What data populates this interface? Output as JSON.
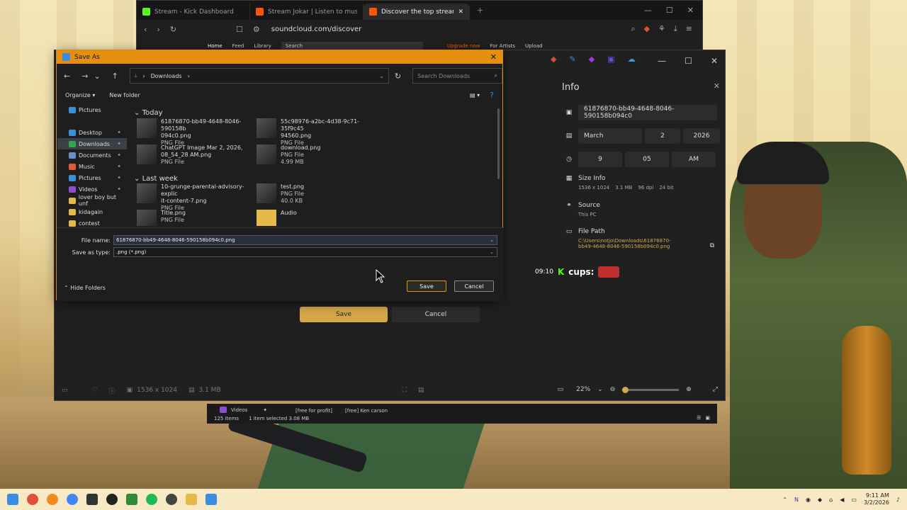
{
  "browser": {
    "tabs": [
      {
        "label": "Stream - Kick Dashboard",
        "color": "#53fc18"
      },
      {
        "label": "Stream Jokar | Listen to music album",
        "color": "#ff5500"
      },
      {
        "label": "Discover the top streamed music",
        "color": "#ff5500"
      }
    ],
    "url": "soundcloud.com/discover",
    "sc_nav": [
      "Home",
      "Feed",
      "Library"
    ],
    "sc_search": "Search",
    "sc_right": [
      "Upgrade now",
      "For Artists",
      "Upload"
    ]
  },
  "viewer": {
    "info_title": "Info",
    "filename": "61876870-bb49-4648-8046-590158b094c0",
    "date": {
      "month": "March",
      "day": "2",
      "year": "2026"
    },
    "time": {
      "hour": "9",
      "minute": "05",
      "ampm": "AM"
    },
    "size_info": {
      "label": "Size Info",
      "dimensions": "1536 x 1024",
      "size": "3.1 MB",
      "dpi": "96 dpi",
      "bits": "24 bit"
    },
    "source": {
      "label": "Source",
      "value": "This PC"
    },
    "file_path": {
      "label": "File Path",
      "line1": "C:\\Users\\notjo\\Downloads\\61876870-",
      "line2": "bb49-4648-8046-590158b094c0.png"
    },
    "chat": {
      "time": "09:10",
      "text": "cups:"
    },
    "save_label": "Save",
    "cancel_label": "Cancel",
    "bottom": {
      "dimensions": "1536 x 1024",
      "size": "3.1 MB",
      "zoom": "22%",
      "zoom_level": 0.0
    }
  },
  "explorer_strip": {
    "folder": "Videos",
    "items": [
      "[free for profit]",
      "[free] Ken carson"
    ],
    "status": "125 items",
    "selected": "1 item selected  3.08 MB"
  },
  "dialog": {
    "title": "Save As",
    "breadcrumb": "Downloads",
    "search_placeholder": "Search Downloads",
    "organize": "Organize",
    "new_folder": "New folder",
    "nav": [
      {
        "label": "Pictures",
        "color": "#3b8fd6",
        "top": true
      },
      {
        "label": "Desktop",
        "color": "#3b8fd6",
        "pinned": true
      },
      {
        "label": "Downloads",
        "color": "#2ea84b",
        "pinned": true,
        "selected": true
      },
      {
        "label": "Documents",
        "color": "#6a8fc8",
        "pinned": true
      },
      {
        "label": "Music",
        "color": "#e05a3a",
        "pinned": true
      },
      {
        "label": "Pictures",
        "color": "#3b8fd6",
        "pinned": true
      },
      {
        "label": "Videos",
        "color": "#8c4fd0",
        "pinned": true
      },
      {
        "label": "lover boy but unf",
        "color": "#e6b84a"
      },
      {
        "label": "kidagain",
        "color": "#e6b84a"
      },
      {
        "label": "contest",
        "color": "#e6b84a"
      }
    ],
    "groups": {
      "today": "Today",
      "last_week": "Last week"
    },
    "files": [
      {
        "name1": "61876870-bb49-4648-8046-590158b",
        "name2": "094c0.png",
        "type": "PNG File",
        "extra": ""
      },
      {
        "name1": "55c98976-a2bc-4d38-9c71-35f9c45",
        "name2": "94560.png",
        "type": "PNG File",
        "extra": ""
      },
      {
        "name1": "ChatGPT Image Mar 2, 2026,",
        "name2": "08_54_28 AM.png",
        "type": "PNG File",
        "extra": ""
      },
      {
        "name1": "download.png",
        "name2": "",
        "type": "PNG File",
        "extra": "4.99 MB"
      },
      {
        "name1": "10-grunge-parental-advisory-explic",
        "name2": "it-content-7.png",
        "type": "PNG File",
        "extra": ""
      },
      {
        "name1": "test.png",
        "name2": "",
        "type": "PNG File",
        "extra": "40.0 KB"
      },
      {
        "name1": "Title.png",
        "name2": "",
        "type": "PNG File",
        "extra": ""
      },
      {
        "name1": "Audio",
        "name2": "",
        "type": "",
        "extra": ""
      }
    ],
    "file_name_label": "File name:",
    "file_name_value": "61876870-bb49-4648-8046-590158b094c0.png",
    "save_type_label": "Save as type:",
    "save_type_value": ".png (*.png)",
    "hide_folders": "Hide Folders",
    "save": "Save",
    "cancel": "Cancel"
  },
  "taskbar": {
    "time": "9:11 AM",
    "date": "3/2/2026"
  },
  "colors": {
    "accent": "#e58f10",
    "link": "#d6a74a"
  }
}
